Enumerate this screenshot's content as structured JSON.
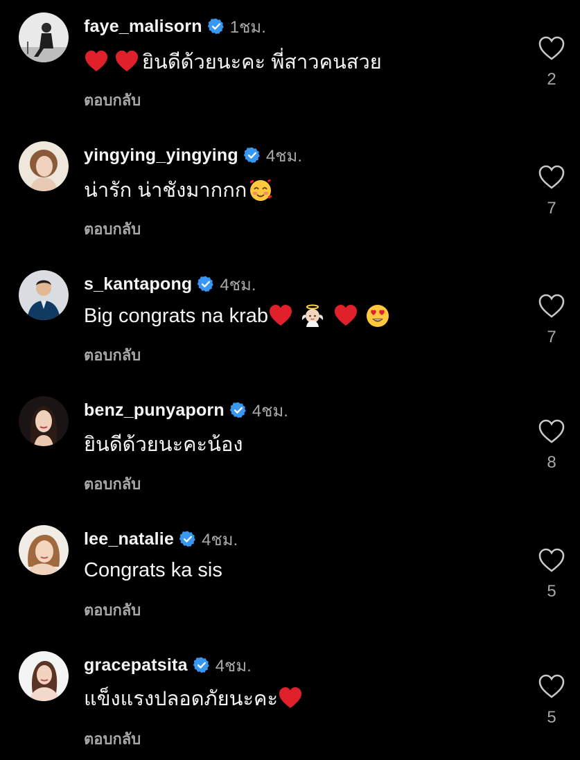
{
  "colors": {
    "background": "#000000",
    "text": "#f5f5f5",
    "muted": "#a8a8a8",
    "verified_badge": "#3897f0",
    "heart": "#e0202a"
  },
  "comments": [
    {
      "username": "faye_malisorn",
      "verified": true,
      "time": "1ชม.",
      "emoji_before": [
        "red-heart",
        "red-heart"
      ],
      "text": "ยินดีด้วยนะคะ พี่สาวคนสวย",
      "emoji_after": [],
      "reply_label": "ตอบกลับ",
      "likes": "2"
    },
    {
      "username": "yingying_yingying",
      "verified": true,
      "time": "4ชม.",
      "emoji_before": [],
      "text": "น่ารัก น่าชังมากกก",
      "emoji_after": [
        "smiling-face-with-hearts"
      ],
      "reply_label": "ตอบกลับ",
      "likes": "7"
    },
    {
      "username": "s_kantapong",
      "verified": true,
      "time": "4ชม.",
      "emoji_before": [],
      "text": "Big congrats na krab",
      "emoji_after": [
        "red-heart",
        "baby-angel",
        "red-heart",
        "heart-eyes"
      ],
      "reply_label": "ตอบกลับ",
      "likes": "7"
    },
    {
      "username": "benz_punyaporn",
      "verified": true,
      "time": "4ชม.",
      "emoji_before": [],
      "text": "ยินดีด้วยนะคะน้อง",
      "emoji_after": [],
      "reply_label": "ตอบกลับ",
      "likes": "8"
    },
    {
      "username": "lee_natalie",
      "verified": true,
      "time": "4ชม.",
      "emoji_before": [],
      "text": "Congrats ka sis",
      "emoji_after": [],
      "reply_label": "ตอบกลับ",
      "likes": "5"
    },
    {
      "username": "gracepatsita",
      "verified": true,
      "time": "4ชม.",
      "emoji_before": [],
      "text": "แข็งแรงปลอดภัยนะคะ",
      "emoji_after": [
        "red-heart"
      ],
      "reply_label": "ตอบกลับ",
      "likes": "5"
    }
  ]
}
